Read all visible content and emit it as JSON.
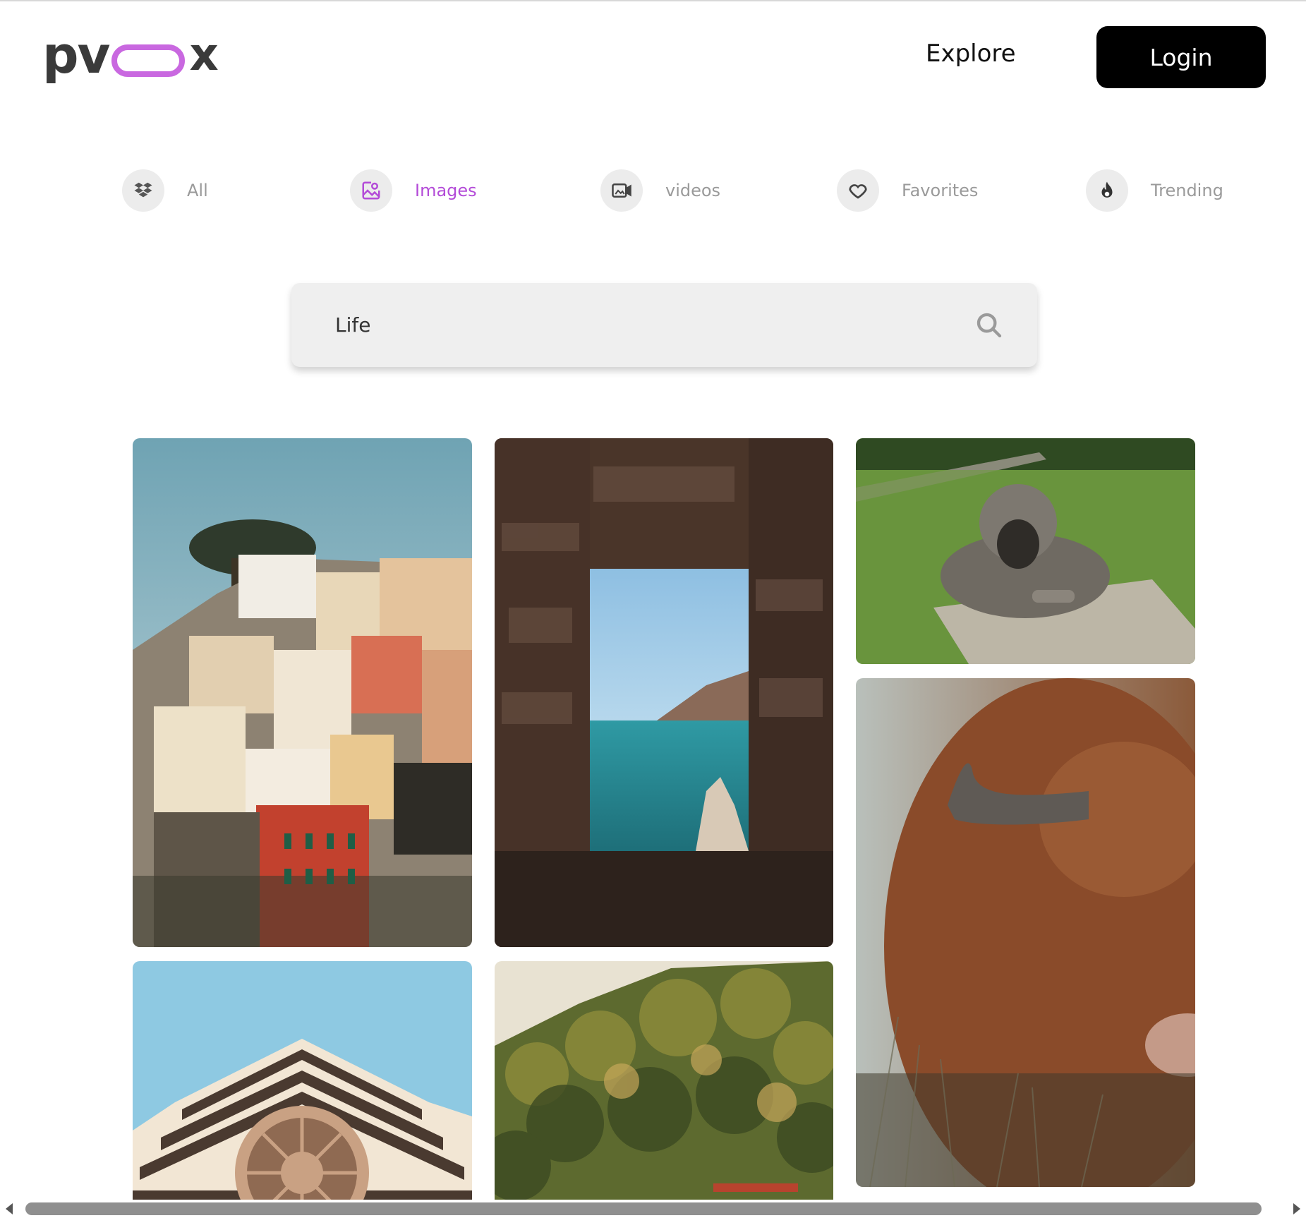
{
  "header": {
    "logo_prefix": "pv",
    "logo_suffix": "x",
    "explore_label": "Explore",
    "login_label": "Login"
  },
  "categories": [
    {
      "label": "All",
      "icon": "dropbox-icon",
      "active": false
    },
    {
      "label": "Images",
      "icon": "image-icon",
      "active": true
    },
    {
      "label": "videos",
      "icon": "video-icon",
      "active": false
    },
    {
      "label": "Favorites",
      "icon": "heart-icon",
      "active": false
    },
    {
      "label": "Trending",
      "icon": "fire-icon",
      "active": false
    }
  ],
  "search": {
    "value": "Life",
    "icon": "search-icon"
  },
  "photos": [
    {
      "subject": "colorful cliffside village houses"
    },
    {
      "subject": "sea view through stone window"
    },
    {
      "subject": "shaggy dog lying on concrete in grass"
    },
    {
      "subject": "highland cow with horns"
    },
    {
      "subject": "striped church facade with rose window"
    },
    {
      "subject": "sunlit forest hillside"
    }
  ],
  "colors": {
    "accent": "#b34bd8",
    "logo_ring": "#c968e0",
    "login_bg": "#000000",
    "search_bg": "#efefef"
  }
}
